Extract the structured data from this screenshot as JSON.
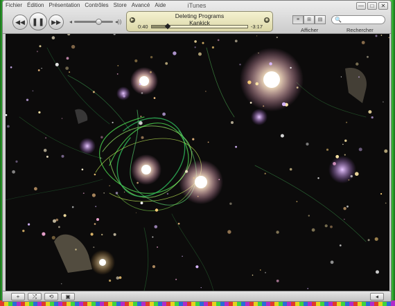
{
  "menu": [
    "Fichier",
    "Édition",
    "Présentation",
    "Contrôles",
    "Store",
    "Avancé",
    "Aide"
  ],
  "window": {
    "title": "iTunes",
    "minimize": "—",
    "maximize": "□",
    "close": "✕"
  },
  "controls": {
    "previous": "◀◀",
    "pause": "❚❚",
    "next": "▶▶",
    "volume_low": "◂",
    "volume_high": "◂))",
    "volume_level": 0.62
  },
  "now_playing": {
    "title": "Deleting Programs",
    "artist": "Kankick",
    "elapsed": "0:40",
    "remaining": "-3:17",
    "progress": 0.17
  },
  "toolbar": {
    "view_label": "Afficher",
    "search_label": "Rechercher",
    "search_icon": "🔍",
    "view_list": "≡",
    "view_grid": "⊞",
    "view_cover": "▤"
  },
  "bottom": {
    "add": "+",
    "shuffle": "⤮",
    "repeat": "⟲",
    "display": "▣",
    "artwork": "◂"
  },
  "colors": {
    "lcd": "#e8e4bc",
    "visualizer_bg": "#0c0b0b",
    "accent_green": "#7fe35a"
  }
}
